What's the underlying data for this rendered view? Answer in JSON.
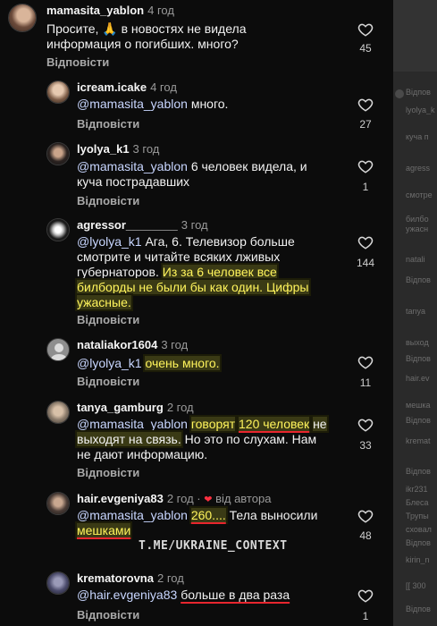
{
  "comments": [
    {
      "username": "mamasita_yablon",
      "time": "4 год",
      "text_parts": [
        "Просите, 🙏 в новостях не видела",
        "информация о погибших. много?"
      ],
      "reply": "Відповісти",
      "likes": "45"
    },
    {
      "username": "icream.icake",
      "time": "4 год",
      "mention": "@mamasita_yablon",
      "text": "много.",
      "reply": "Відповісти",
      "likes": "27"
    },
    {
      "username": "lyolya_k1",
      "time": "3 год",
      "mention": "@mamasita_yablon",
      "text_line1": "6 человек видела, и",
      "text_line2": "куча пострадавших",
      "reply": "Відповісти",
      "likes": "1"
    },
    {
      "username": "agressor________",
      "time": "3 год",
      "mention": "@lyolya_k1",
      "text_line1": "Ага, 6. Телевизор больше",
      "text_line2": "смотрите и читайте всяких лживых",
      "text_line3": "губернаторов.",
      "hl_line3": "Из за 6 человек все",
      "hl_line4": "билборды не были бы как один. Цифры",
      "hl_line5": "ужасные.",
      "reply": "Відповісти",
      "likes": "144"
    },
    {
      "username": "nataliakor1604",
      "time": "3 год",
      "mention": "@lyolya_k1",
      "hl_text": "очень много.",
      "reply": "Відповісти",
      "likes": "11"
    },
    {
      "username": "tanya_gamburg",
      "time": "2 год",
      "mention": "@mamasita_yablon",
      "hl_a": "говорят",
      "hl_b": "120 человек",
      "hl_c": "не",
      "hl_d": "выходят на связь.",
      "text_rest1": "Но это по слухам. Нам",
      "text_rest2": "не дают информацию.",
      "reply": "Відповісти",
      "likes": "33"
    },
    {
      "username": "hair.evgeniya83",
      "time": "2 год",
      "author_badge": "від автора",
      "mention": "@mamasita_yablon",
      "hl_a": "260....",
      "text_mid": "Тела выносили",
      "hl_b": "мешками",
      "reply": "Відповісти",
      "likes": "48"
    },
    {
      "username": "krematorovna",
      "time": "2 год",
      "mention": "@hair.evgeniya83",
      "hl_text": "больше в два раза",
      "reply": "Відповісти",
      "likes": "1"
    }
  ],
  "watermark": "T.ME/UKRAINE_CONTEXT",
  "background_ghost": [
    "Відпов",
    "lyolya_k",
    "куча п",
    "agress",
    "смотре",
    "билбо",
    "ужасн",
    "natali",
    "Відпов",
    "tanya",
    "выход",
    "Відпов",
    "hair.ev",
    "мешка",
    "Відпов",
    "kremat",
    "Відпов",
    "ikr231",
    "Блеса",
    "Трупы",
    "сховал",
    "Відпов",
    "kirin_n",
    "[[ 300",
    "Відпов"
  ],
  "colors": {
    "accent_highlight": "#fff45c",
    "underline": "#e8262e",
    "mention": "#c8d6ff",
    "heart": "#ff3040"
  }
}
